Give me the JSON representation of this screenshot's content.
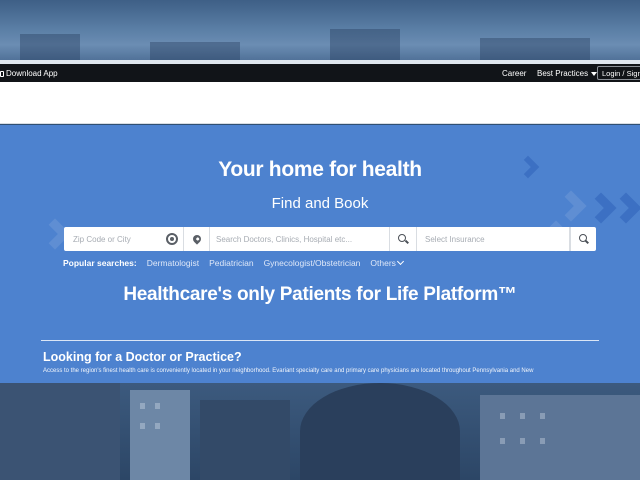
{
  "topbar": {
    "download_label": "Download App",
    "career_label": "Career",
    "best_practices_label": "Best Practices",
    "login_label": "Login / Sign Up"
  },
  "hero": {
    "title": "Your home for health",
    "subtitle": "Find and Book",
    "tagline": "Healthcare's only Patients for Life Platform™",
    "background_color": "#4d82cf"
  },
  "search": {
    "zip_placeholder": "Zip Code or City",
    "doctor_placeholder": "Search Doctors, Clinics, Hospital etc...",
    "insurance_placeholder": "Select Insurance"
  },
  "popular": {
    "label": "Popular searches:",
    "items": [
      "Dermatologist",
      "Pediatrician",
      "Gynecologist/Obstetrician"
    ],
    "others_label": "Others"
  },
  "practice": {
    "heading": "Looking for a Doctor or Practice?",
    "description": "Access to the region's finest health care is conveniently located in your neighborhood. Evariant specialty care and primary care physicians are located throughout Pennsylvania and New"
  }
}
